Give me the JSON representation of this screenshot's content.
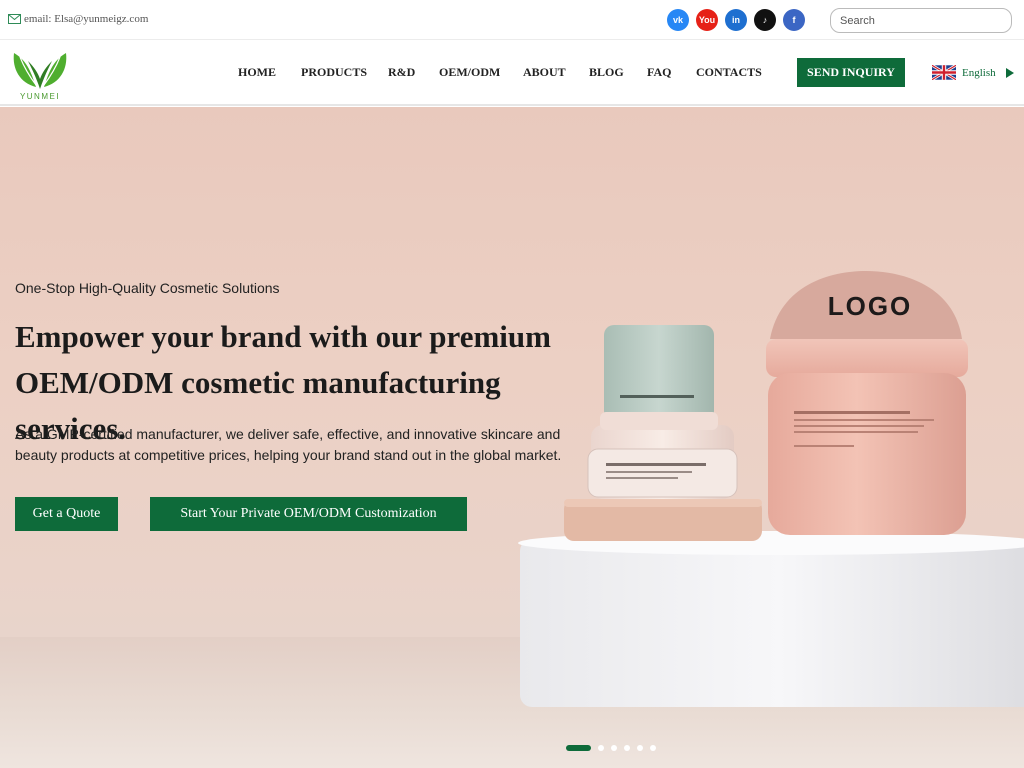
{
  "topbar": {
    "email": "email: Elsa@yunmeigz.com",
    "search_placeholder": "Search",
    "socials": [
      {
        "name": "vk-icon",
        "glyph": "vk",
        "color": "#2787f5"
      },
      {
        "name": "youtube-icon",
        "glyph": "You",
        "color": "#e62117"
      },
      {
        "name": "linkedin-icon",
        "glyph": "in",
        "color": "#1e6fd0"
      },
      {
        "name": "tiktok-icon",
        "glyph": "♪",
        "color": "#111111"
      },
      {
        "name": "facebook-icon",
        "glyph": "f",
        "color": "#3b66c4"
      }
    ]
  },
  "header": {
    "logo_text": "YUNMEI",
    "nav": [
      "HOME",
      "PRODUCTS",
      "R&D",
      "OEM/ODM",
      "ABOUT",
      "BLOG",
      "FAQ",
      "CONTACTS"
    ],
    "inquiry_label": "SEND INQUIRY",
    "language": "English"
  },
  "hero": {
    "tagline": "One-Stop High-Quality Cosmetic Solutions",
    "headline_line1": "Empower your brand with our premium",
    "headline_line2": "OEM/ODM cosmetic manufacturing services.",
    "description": "As a GMP-certified manufacturer, we deliver safe, effective, and innovative skincare and beauty products at competitive prices, helping your brand stand out in the global market.",
    "quote_button": "Get a Quote",
    "customize_button": "Start Your Private OEM/ODM Customization",
    "product_logo": "LOGO",
    "slide_count": 6,
    "active_slide": 1
  },
  "colors": {
    "brand_green": "#0e6b3a",
    "logo_green": "#4a9a2f"
  }
}
